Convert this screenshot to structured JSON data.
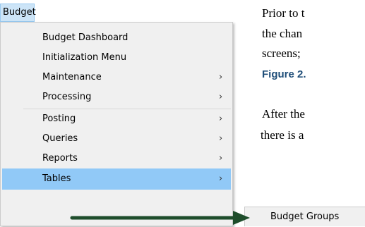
{
  "menubar": {
    "title": "Budget"
  },
  "menu": {
    "items": [
      {
        "label": "Budget Dashboard",
        "submenu": false
      },
      {
        "label": "Initialization Menu",
        "submenu": false
      },
      {
        "label": "Maintenance",
        "submenu": true
      },
      {
        "label": "Processing",
        "submenu": true
      },
      {
        "label": "Posting",
        "submenu": true
      },
      {
        "label": "Queries",
        "submenu": true
      },
      {
        "label": "Reports",
        "submenu": true
      },
      {
        "label": "Tables",
        "submenu": true,
        "highlighted": true
      }
    ],
    "chevron": "›"
  },
  "submenu": {
    "items": [
      {
        "label": "Budget Groups"
      }
    ]
  },
  "document": {
    "line1": "Prior to t",
    "line2": "the chan",
    "line3": "screens;",
    "line4": "Figure 2.",
    "line5": "After the",
    "line6": "there is a"
  },
  "colors": {
    "highlight": "#91c9f7",
    "arrow": "#1e4d2b",
    "figure_ref": "#1f4e79"
  }
}
